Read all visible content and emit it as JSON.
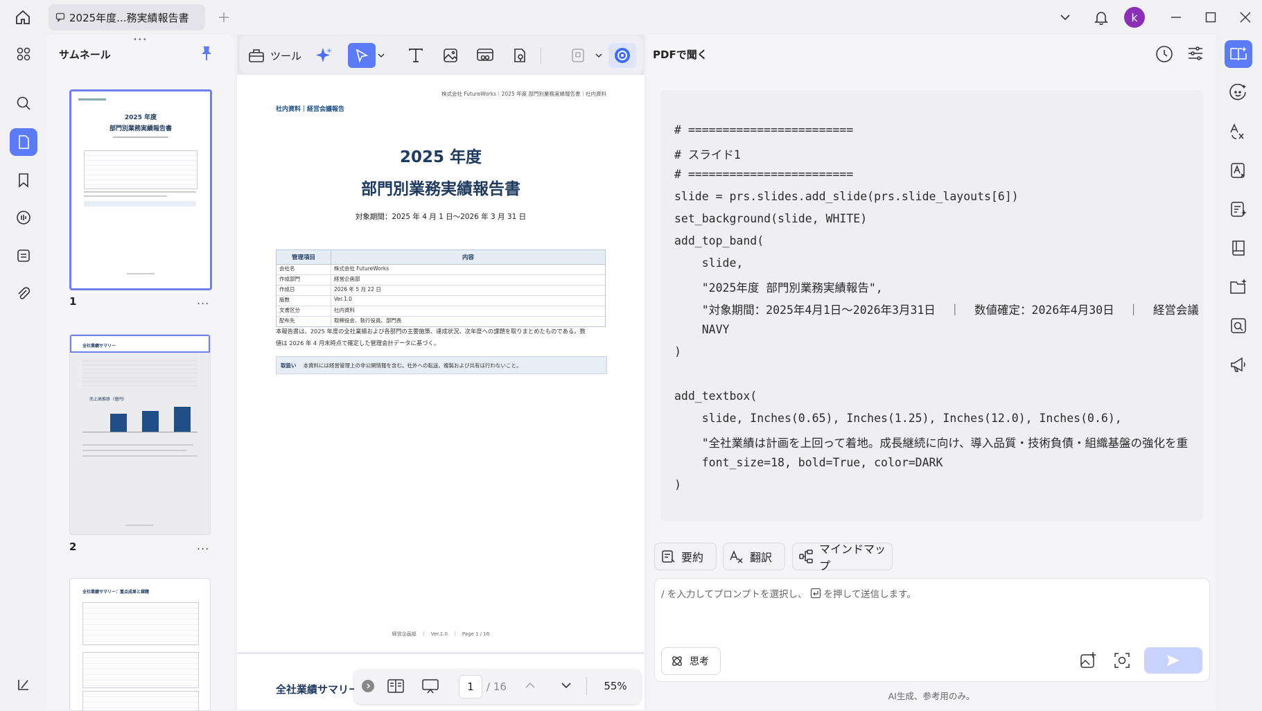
{
  "window": {
    "tab_title": "2025年度...務実績報告書",
    "avatar_letter": "k"
  },
  "sidebar": {
    "title": "サムネール",
    "pages": [
      {
        "number": "1",
        "more": "..."
      },
      {
        "number": "2",
        "more": "..."
      }
    ]
  },
  "toolbar": {
    "tools_label": "ツール"
  },
  "document": {
    "header_right": "株式会社 FutureWorks｜2025 年度 部門別業務実績報告書｜社内資料",
    "header_left": "社内資料｜経営会議報告",
    "title_year": "2025 年度",
    "title_main": "部門別業務実績報告書",
    "period": "対象期間：2025 年 4 月 1 日〜2026 年 3 月 31 日",
    "table_headers": [
      "管理項目",
      "内容"
    ],
    "table_rows": [
      [
        "会社名",
        "株式会社 FutureWorks"
      ],
      [
        "作成部門",
        "経営企画部"
      ],
      [
        "作成日",
        "2026 年 5 月 22 日"
      ],
      [
        "版数",
        "Ver.1.0"
      ],
      [
        "文書区分",
        "社内資料"
      ],
      [
        "配布先",
        "取締役会、執行役員、部門長"
      ]
    ],
    "body_line1": "本報告書は、2025 年度の全社業績および各部門の主要施策、達成状況、次年度への課題を取りまとめたものである。数",
    "body_line2": "値は 2026 年 4 月末時点で確定した管理会計データに基づく。",
    "notice_label": "取扱い",
    "notice_text": "本資料には経営管理上の非公開情報を含む。社外への転送、複製および共有は行わないこと。",
    "footer": "経営企画部　｜　Ver.1.0　｜　Page 1 / 16",
    "next_page_title": "全社業績サマリー"
  },
  "thumbnails": {
    "t1_title_year": "2025 年度",
    "t1_title_main": "部門別業務実績報告書",
    "t2_header": "全社業績サマリー",
    "t2_chart_title": "売上高推移（億円）",
    "t3_header": "全社業績サマリー：重点成果と課題"
  },
  "bottom_nav": {
    "current_page": "1",
    "total_pages": "/ 16",
    "zoom": "55%"
  },
  "ai_panel": {
    "title": "PDFで聞く",
    "code_lines": [
      "# ========================",
      "# スライド1",
      "# ========================",
      "slide = prs.slides.add_slide(prs.slide_layouts[6])",
      "set_background(slide, WHITE)",
      "add_top_band(",
      "    slide,",
      "    \"2025年度 部門別業務実績報告\",",
      "    \"対象期間：2025年4月1日〜2026年3月31日  ｜  数値確定：2026年4月30日  ｜  経営会議",
      "    NAVY",
      ")",
      "",
      "add_textbox(",
      "    slide, Inches(0.65), Inches(1.25), Inches(12.0), Inches(0.6),",
      "    \"全社業績は計画を上回って着地。成長継続に向け、導入品質・技術負債・組織基盤の強化を重",
      "    font_size=18, bold=True, color=DARK",
      ")"
    ],
    "chip_summary": "要約",
    "chip_translate": "翻訳",
    "chip_mindmap": "マインドマップ",
    "prompt_placeholder_a": "/ を入力してプロンプトを選択し、",
    "prompt_placeholder_b": "を押して送信します。",
    "think_label": "思考",
    "disclaimer": "AI生成、参考用のみ。"
  },
  "colors": {
    "accent": "#5b7cf6",
    "navy": "#1f3a5f",
    "send_disabled": "#c9d2fb"
  }
}
